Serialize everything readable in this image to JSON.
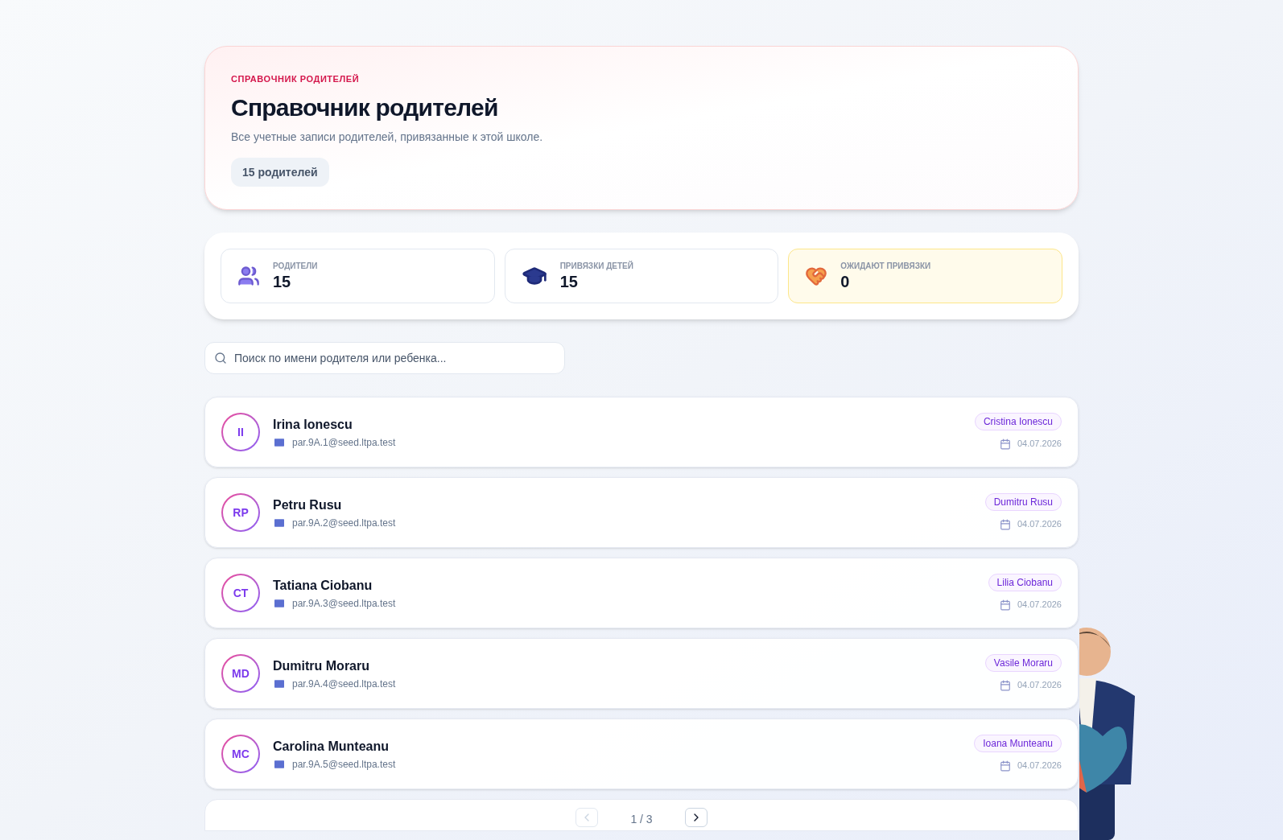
{
  "header": {
    "eyebrow": "СПРАВОЧНИК РОДИТЕЛЕЙ",
    "title": "Справочник родителей",
    "subtitle": "Все учетные записи родителей, привязанные к этой школе.",
    "count_badge": "15 родителей"
  },
  "stats": [
    {
      "kind": "parents",
      "label": "РОДИТЕЛИ",
      "value": "15",
      "highlighted": false
    },
    {
      "kind": "links",
      "label": "ПРИВЯЗКИ ДЕТЕЙ",
      "value": "15",
      "highlighted": false
    },
    {
      "kind": "pending",
      "label": "ОЖИДАЮТ ПРИВЯЗКИ",
      "value": "0",
      "highlighted": true
    }
  ],
  "search": {
    "placeholder": "Поиск по имени родителя или ребенка..."
  },
  "parents": [
    {
      "initials": "II",
      "name": "Irina Ionescu",
      "email": "par.9A.1@seed.ltpa.test",
      "child": "Cristina Ionescu",
      "date": "04.07.2026"
    },
    {
      "initials": "RP",
      "name": "Petru Rusu",
      "email": "par.9A.2@seed.ltpa.test",
      "child": "Dumitru Rusu",
      "date": "04.07.2026"
    },
    {
      "initials": "CT",
      "name": "Tatiana Ciobanu",
      "email": "par.9A.3@seed.ltpa.test",
      "child": "Lilia Ciobanu",
      "date": "04.07.2026"
    },
    {
      "initials": "MD",
      "name": "Dumitru Moraru",
      "email": "par.9A.4@seed.ltpa.test",
      "child": "Vasile Moraru",
      "date": "04.07.2026"
    },
    {
      "initials": "MC",
      "name": "Carolina Munteanu",
      "email": "par.9A.5@seed.ltpa.test",
      "child": "Ioana Munteanu",
      "date": "04.07.2026"
    }
  ],
  "pagination": {
    "page": "1 / 3",
    "prev_disabled": true
  }
}
